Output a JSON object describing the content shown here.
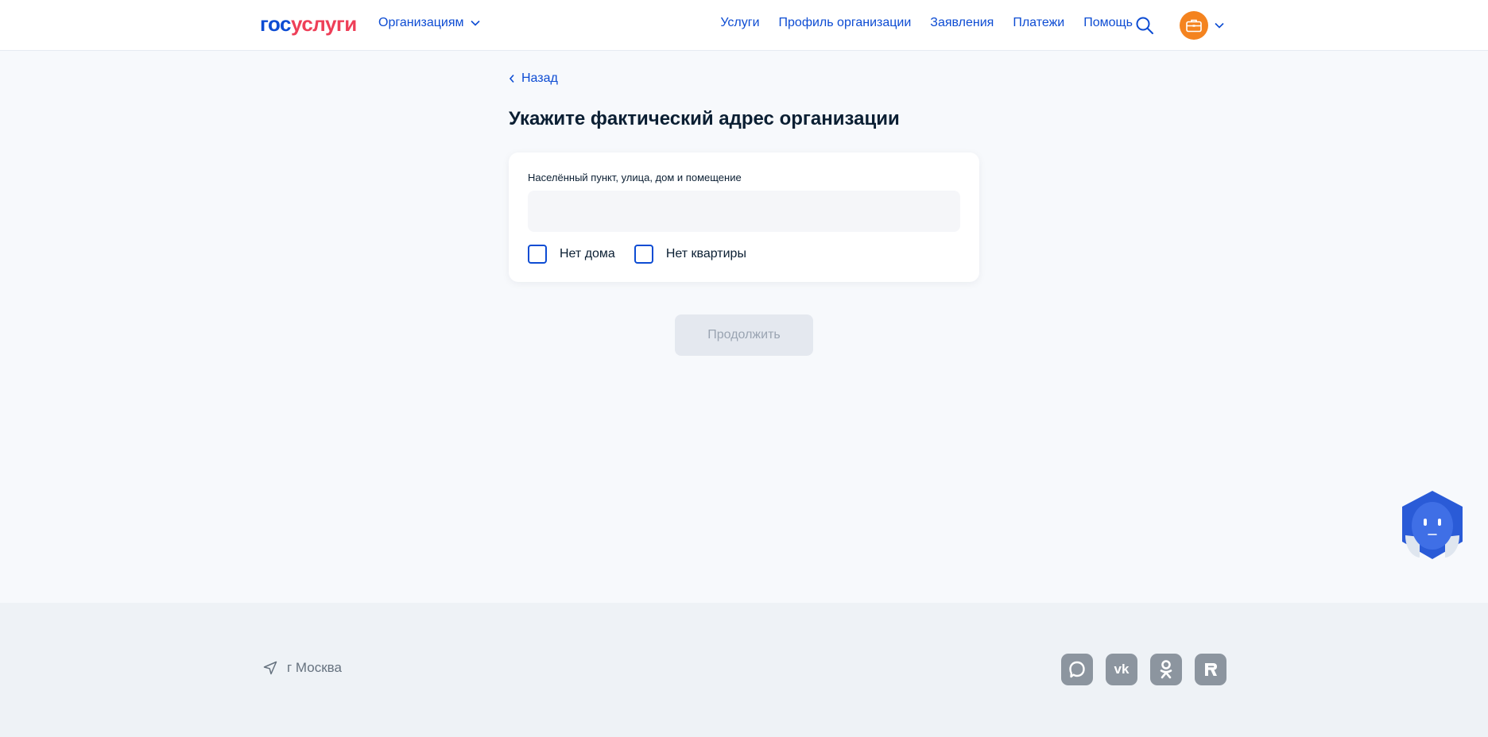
{
  "header": {
    "logo_part1": "гос",
    "logo_part2": "услуги",
    "org_dropdown": "Организациям",
    "nav": [
      "Услуги",
      "Профиль организации",
      "Заявления",
      "Платежи",
      "Помощь"
    ]
  },
  "main": {
    "back_label": "Назад",
    "title": "Укажите фактический адрес организации",
    "field_label": "Населённый пункт, улица, дом и помещение",
    "field_value": "",
    "checkbox_no_house": "Нет дома",
    "checkbox_no_apartment": "Нет квартиры",
    "continue_label": "Продолжить"
  },
  "footer": {
    "city": "г Москва",
    "socials": [
      "max",
      "vk",
      "ok",
      "rutube"
    ]
  },
  "colors": {
    "brand_blue": "#0d4cd3",
    "brand_red": "#ee3f58",
    "avatar_orange": "#f4831f",
    "page_bg": "#f7f9fc",
    "footer_bg": "#eef2f6"
  }
}
